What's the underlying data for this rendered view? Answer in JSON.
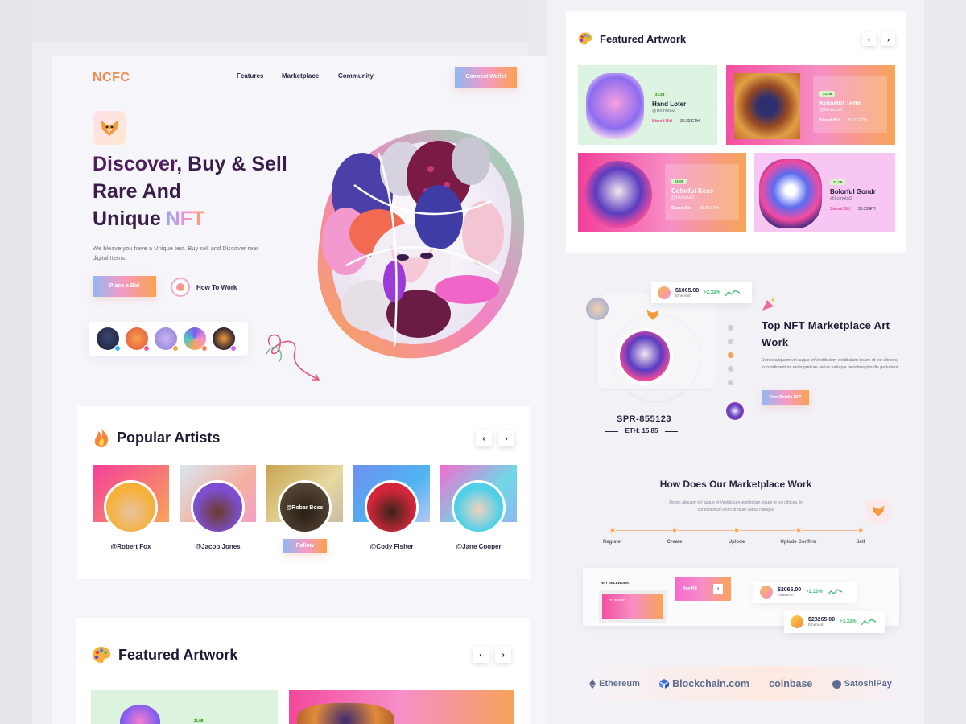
{
  "header": {
    "logo": "NCFC",
    "nav": [
      "Features",
      "Marketplace",
      "Community"
    ],
    "connect_label": "Connect Wallet"
  },
  "hero": {
    "title_line1_a": "Discover,",
    "title_line1_b": "Buy & Sell",
    "title_line2": "Rare And",
    "title_line3": "Unique",
    "title_highlight": "NFT",
    "description": "We bleave you have a Unique test. Buy sell and Discover rear digital Items.",
    "bid_label": "Place a Bid",
    "how_label": "How To Work"
  },
  "artists": {
    "title": "Popular Artists",
    "items": [
      {
        "name": "@Robert Fox"
      },
      {
        "name": "@Jacob Jones"
      },
      {
        "name": "@Robar Boss",
        "follow_label": "Follow"
      },
      {
        "name": "@Cody Fisher"
      },
      {
        "name": "@Jane Cooper"
      }
    ]
  },
  "featured_left": {
    "title": "Featured Artwork",
    "tag": "21.08"
  },
  "featured": {
    "title": "Featured Artwork",
    "cards": [
      {
        "tag": "21.08",
        "title": "Hand Loter",
        "handle": "@Hoinotal2",
        "label": "Stared Bid",
        "price": "30.23 ETH"
      },
      {
        "tag": "21.08",
        "title": "Kolorful Teda",
        "handle": "@Hoinotal2",
        "label": "Stared Bid",
        "price": "30.23 ETH"
      },
      {
        "tag": "21.08",
        "title": "Colorful Kess",
        "handle": "@Hoinotal2",
        "label": "Stared Bid",
        "price": "30.23 ETH"
      },
      {
        "tag": "21.08",
        "title": "Bolorful Gondr",
        "handle": "@Loinotal2",
        "label": "Stared Bid",
        "price": "30.23 ETH"
      }
    ]
  },
  "top_nft": {
    "title": "Top NFT Marketplace Art Work",
    "description": "Donec aliquam vel augue et Vestibulum vestibulum ipsum ut leo ultrices, in condimentum enim pretium varius natoque penatmagnis dis parturient.",
    "details_label": "View Details NFT",
    "price_amount": "$1065.00",
    "price_network": "Ethereum",
    "price_pct": "+2.32%",
    "code": "SPR-855123",
    "eth": "ETH: 15.85"
  },
  "how_it_works": {
    "title": "How Does Our Marketplace Work",
    "description": "Donec aliquam vel augue et Vestibulum vestibulum ipsum ut leo ultrices, in condimentum enim pretium varius natoque",
    "steps": [
      "Register",
      "Create",
      "Uplode",
      "Uplode Confirm",
      "Sell"
    ]
  },
  "sell_work": {
    "label": "NFT SELLWORK",
    "art_worker": "Art Worker",
    "buy_label": "Buy Nft",
    "price1_amount": "$2065.00",
    "price1_network": "Ethereum",
    "price1_pct": "+2.32%",
    "price2_amount": "$28265.00",
    "price2_network": "Ethereum",
    "price2_pct": "+3.32%"
  },
  "brands": [
    "Ethereum",
    "Blockchain.com",
    "coinbase",
    "SatoshiPay"
  ],
  "colors": {
    "accent_orange": "#f2884b",
    "accent_pink": "#f58fd0",
    "accent_blue": "#8fb8f0",
    "dark_title": "#3a1e4a"
  }
}
